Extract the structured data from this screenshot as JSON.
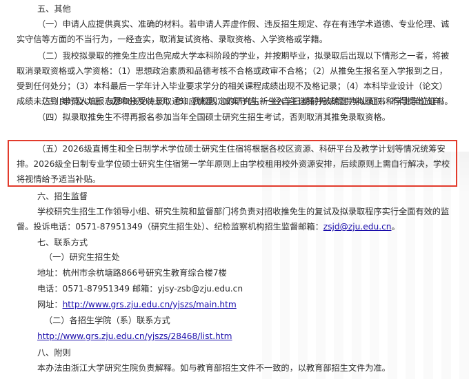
{
  "sec5": {
    "title": "五、其他",
    "p1": "（一）申请人应提供真实、准确的材料。若申请人弄虚作假、违反招生规定、存在有违学术道德、专业伦理、诚实守信等方面的不当行为，一经查实，取消复试资格、录取资格、入学资格或学籍。",
    "p2": "（二）我校拟录取的推免生应出色完成大学本科阶段的学业，并按期毕业，拟录取后出现以下情形之一者，将被取消录取资格或入学资格：（1）思想政治素质和品德考核不合格或政审不合格；（2）从推免生报名至入学报到之日，受到任何处分；（3）本科最后一学年计入毕业要求学分的相关课程成绩出现不及格记录；（4）本科毕业设计（论文）成绩未达到良好及以上（或80分及以上）；（5）我校规定的研究生新生入学日期前无法提供毕业证书和学士学位证书。",
    "p3": "（三）申请人填报志愿和接受待录取通知应慎重，诚实守信，一经自主选择并被确定为拟录取，不得提出放弃。",
    "p4": "（四）拟录取推免生不得再报名参加当年全国硕士研究生招生考试，否则取消其推免录取资格。",
    "p5": "（五）2026级直博生和全日制学术学位硕士研究生住宿将根据各校区资源、科研平台及教学计划等情况统筹安排。2026级全日制专业学位硕士研究生住宿第一学年原则上由学校租用校外资源安排，后续原则上需自行解决，学校将视情给予适当补贴。"
  },
  "sec6": {
    "title": "六、招生监督",
    "p1": "学校研究生招生工作领导小组、研究生院和监督部门将负责对招收推免生的复试及拟录取程序实行全面有效的监督。投诉电话：0571-87951349（研究生招生处）、纪检监察机构招生监督邮箱：",
    "email": "zsjd@zju.edu.cn",
    "p1_end": "。"
  },
  "sec7": {
    "title": "七、联系方式",
    "sub1": "（一）研究生招生处",
    "address": "地址：杭州市余杭塘路866号研究生教育综合楼7楼",
    "phone": "电话：0571-87951349  邮箱：yjsy-zsb@zju.edu.cn",
    "site_label": "网址：",
    "site_url": "http://www.grs.zju.edu.cn/yjszs/main.htm",
    "sub2": "（二）各招生学院（系）联系方式",
    "list_url": "http://www.grs.zju.edu.cn/yjszs/28468/list.htm"
  },
  "sec8": {
    "title": "八、附则",
    "p1": "本办法由浙江大学研究生院负责解释。如与教育部招生文件不一致的，以教育部招生文件为准。"
  },
  "colors": {
    "highlight_border": "#e23a2b",
    "link": "#1a0dab"
  }
}
